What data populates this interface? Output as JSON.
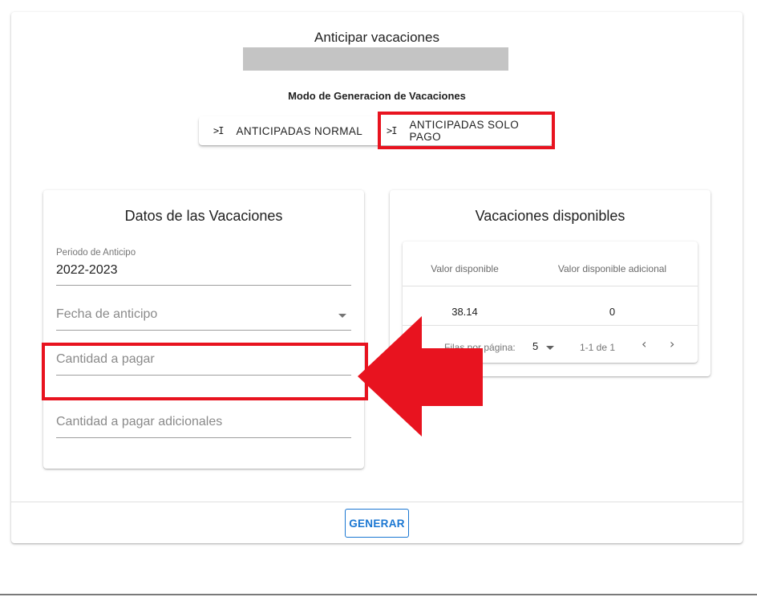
{
  "page": {
    "title": "Anticipar vacaciones",
    "mode_label": "Modo de Generacion de Vacaciones",
    "toggle_options": [
      {
        "icon": "skip-to-end-icon",
        "glyph": ">I",
        "label": "ANTICIPADAS NORMAL"
      },
      {
        "icon": "skip-to-end-icon",
        "glyph": ">I",
        "label": "ANTICIPADAS SOLO PAGO"
      }
    ],
    "generate_label": "GENERAR"
  },
  "datos": {
    "title": "Datos de las Vacaciones",
    "periodo_label": "Periodo de Anticipo",
    "periodo_value": "2022-2023",
    "fecha_placeholder": "Fecha de anticipo",
    "cantidad_placeholder": "Cantidad a pagar",
    "adicional_placeholder": "Cantidad a pagar adicionales"
  },
  "disponibles": {
    "title": "Vacaciones disponibles",
    "headers": [
      "Valor disponible",
      "Valor disponible adicional"
    ],
    "rows": [
      [
        "38.14",
        "0"
      ]
    ],
    "rows_per_page_label": "Filas por página:",
    "rows_per_page_value": "5",
    "range": "1-1 de 1",
    "prev_glyph": "‹",
    "next_glyph": "›"
  },
  "colors": {
    "highlight": "#e8131f",
    "primary": "#1976d2"
  }
}
